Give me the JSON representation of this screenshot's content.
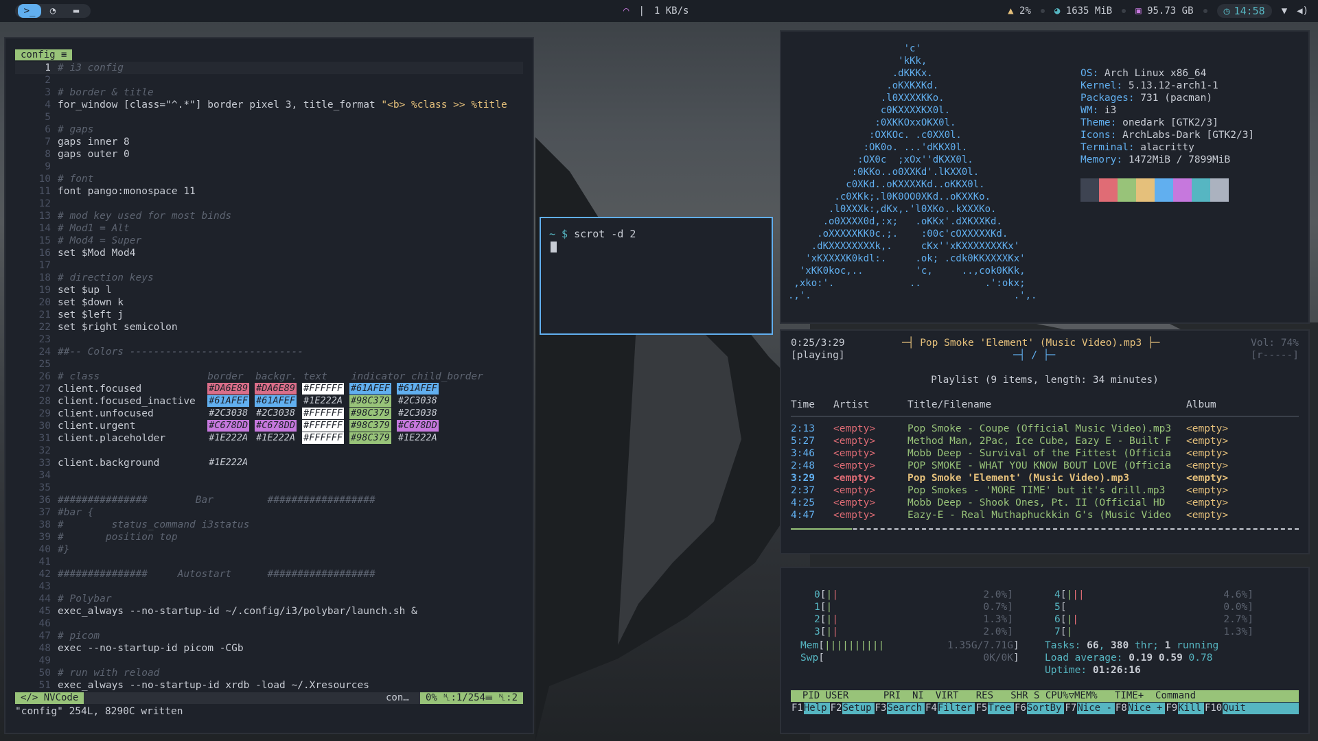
{
  "topbar": {
    "workspaces": [
      {
        "icon": "terminal-icon",
        "glyph": ">_",
        "active": true
      },
      {
        "icon": "firefox-icon",
        "glyph": "◔",
        "active": false
      },
      {
        "icon": "folder-icon",
        "glyph": "▬",
        "active": false
      }
    ],
    "network_speed": "1 KB/s",
    "cpu": "2%",
    "memory": "1635 MiB",
    "disk": "95.73 GB",
    "time": "14:58"
  },
  "editor": {
    "tab": "config ≡",
    "lines": [
      {
        "n": "1",
        "t": "# i3 config",
        "c": "cm"
      },
      {
        "n": "2",
        "t": "",
        "c": "txt"
      },
      {
        "n": "3",
        "t": "# border & title",
        "c": "cm"
      },
      {
        "n": "4",
        "t": "for_window [class=\"^.*\"] border pixel 3, title_format ",
        "s": "\"<b> %class >> %title",
        "c": "txt"
      },
      {
        "n": "5",
        "t": "",
        "c": "txt"
      },
      {
        "n": "6",
        "t": "# gaps",
        "c": "cm"
      },
      {
        "n": "7",
        "t": "gaps inner 8",
        "c": "txt"
      },
      {
        "n": "8",
        "t": "gaps outer 0",
        "c": "txt"
      },
      {
        "n": "9",
        "t": "",
        "c": "txt"
      },
      {
        "n": "10",
        "t": "# font",
        "c": "cm"
      },
      {
        "n": "11",
        "t": "font pango:monospace 11",
        "c": "txt"
      },
      {
        "n": "12",
        "t": "",
        "c": "txt"
      },
      {
        "n": "13",
        "t": "# mod key used for most binds",
        "c": "cm"
      },
      {
        "n": "14",
        "t": "# Mod1 = Alt",
        "c": "cm"
      },
      {
        "n": "15",
        "t": "# Mod4 = Super",
        "c": "cm"
      },
      {
        "n": "16",
        "t": "set $Mod Mod4",
        "c": "txt"
      },
      {
        "n": "17",
        "t": "",
        "c": "txt"
      },
      {
        "n": "18",
        "t": "# direction keys",
        "c": "cm"
      },
      {
        "n": "19",
        "t": "set $up l",
        "c": "txt"
      },
      {
        "n": "20",
        "t": "set $down k",
        "c": "txt"
      },
      {
        "n": "21",
        "t": "set $left j",
        "c": "txt"
      },
      {
        "n": "22",
        "t": "set $right semicolon",
        "c": "txt"
      },
      {
        "n": "23",
        "t": "",
        "c": "txt"
      },
      {
        "n": "24",
        "t": "##-- Colors -----------------------------",
        "c": "cm"
      },
      {
        "n": "25",
        "t": "",
        "c": "txt"
      },
      {
        "n": "26",
        "t": "# class                  border  backgr. text    indicator child_border",
        "c": "cm"
      },
      {
        "n": "27",
        "t": "client.focused           ",
        "sw": [
          [
            "#DA6E89",
            "#DA6E89",
            "#1e222a"
          ],
          [
            "#DA6E89",
            "#DA6E89",
            "#1e222a"
          ],
          [
            "#FFFFFF",
            "#FFFFFF",
            "#1e222a"
          ],
          [
            "#61AFEF",
            "#61AFEF",
            "#1e222a"
          ],
          [
            "#61AFEF",
            "#61AFEF",
            "#1e222a"
          ]
        ],
        "c": "txt"
      },
      {
        "n": "28",
        "t": "client.focused_inactive  ",
        "sw": [
          [
            "#61AFEF",
            "#61AFEF",
            "#1e222a"
          ],
          [
            "#61AFEF",
            "#61AFEF",
            "#1e222a"
          ],
          [
            "#1E222A",
            "",
            "#c8ccd4"
          ],
          [
            "#98C379",
            "#98C379",
            "#1e222a"
          ],
          [
            "#2C3038",
            "",
            "#c8ccd4"
          ]
        ],
        "c": "txt"
      },
      {
        "n": "29",
        "t": "client.unfocused         ",
        "sw": [
          [
            "#2C3038",
            "",
            "#c8ccd4"
          ],
          [
            "#2C3038",
            "",
            "#c8ccd4"
          ],
          [
            "#FFFFFF",
            "#FFFFFF",
            "#1e222a"
          ],
          [
            "#98C379",
            "#98C379",
            "#1e222a"
          ],
          [
            "#2C3038",
            "",
            "#c8ccd4"
          ]
        ],
        "c": "txt"
      },
      {
        "n": "30",
        "t": "client.urgent            ",
        "sw": [
          [
            "#C678DD",
            "#C678DD",
            "#1e222a"
          ],
          [
            "#C678DD",
            "#C678DD",
            "#1e222a"
          ],
          [
            "#FFFFFF",
            "#FFFFFF",
            "#1e222a"
          ],
          [
            "#98C379",
            "#98C379",
            "#1e222a"
          ],
          [
            "#C678DD",
            "#C678DD",
            "#1e222a"
          ]
        ],
        "c": "txt"
      },
      {
        "n": "31",
        "t": "client.placeholder       ",
        "sw": [
          [
            "#1E222A",
            "",
            "#c8ccd4"
          ],
          [
            "#1E222A",
            "",
            "#c8ccd4"
          ],
          [
            "#FFFFFF",
            "#FFFFFF",
            "#1e222a"
          ],
          [
            "#98C379",
            "#98C379",
            "#1e222a"
          ],
          [
            "#1E222A",
            "",
            "#c8ccd4"
          ]
        ],
        "c": "txt"
      },
      {
        "n": "32",
        "t": "",
        "c": "txt"
      },
      {
        "n": "33",
        "t": "client.background        ",
        "sw": [
          [
            "#1E222A",
            "",
            "#c8ccd4"
          ]
        ],
        "c": "txt"
      },
      {
        "n": "34",
        "t": "",
        "c": "txt"
      },
      {
        "n": "35",
        "t": "",
        "c": "txt"
      },
      {
        "n": "36",
        "t": "###############        Bar         ##################",
        "c": "cm"
      },
      {
        "n": "37",
        "t": "#bar {",
        "c": "cm"
      },
      {
        "n": "38",
        "t": "#        status_command i3status",
        "c": "cm"
      },
      {
        "n": "39",
        "t": "#       position top",
        "c": "cm"
      },
      {
        "n": "40",
        "t": "#}",
        "c": "cm"
      },
      {
        "n": "41",
        "t": "",
        "c": "txt"
      },
      {
        "n": "42",
        "t": "###############     Autostart      ##################",
        "c": "cm"
      },
      {
        "n": "43",
        "t": "",
        "c": "txt"
      },
      {
        "n": "44",
        "t": "# Polybar",
        "c": "cm"
      },
      {
        "n": "45",
        "t": "exec_always --no-startup-id ~/.config/i3/polybar/launch.sh &",
        "c": "txt"
      },
      {
        "n": "46",
        "t": "",
        "c": "txt"
      },
      {
        "n": "47",
        "t": "# picom",
        "c": "cm"
      },
      {
        "n": "48",
        "t": "exec --no-startup-id picom -CGb",
        "c": "txt"
      },
      {
        "n": "49",
        "t": "",
        "c": "txt"
      },
      {
        "n": "50",
        "t": "# run with reload",
        "c": "cm"
      },
      {
        "n": "51",
        "t": "exec_always --no-startup-id xrdb -load ~/.Xresources",
        "c": "txt"
      }
    ],
    "status": {
      "mode": "</> NVCode",
      "file": "con…",
      "position": "0% ␤:1/254☰ ␤:2"
    },
    "cmdline": "\"config\" 254L, 8290C written"
  },
  "terminal": {
    "prompt": "~ $ ",
    "command": "scrot -d 2"
  },
  "neofetch": {
    "logo": "                    'c'\n                   'kKk,\n                  .dKKKx.\n                 .oKXKXKd.\n                .l0XXXXKKo.\n                c0KXXXXKX0l.\n               :0XKKOxxOKX0l.\n              :OXKOc. .c0XX0l.\n             :OK0o. ...'dKKX0l.\n            :OX0c  ;xOx''dKXX0l.\n           :0KKo..o0XXKd'.lKXX0l.\n          c0XKd..oKXXXXKd..oKKX0l.\n        .c0XKk;.l0K0OO0XKd..oKXXKo.\n       .l0XXXk:,dKx,.'l0XKo..kXXXKo.\n      .o0XXXX0d,:x;   .oKKx'.dXKXXKd.\n     .oXXXXXKK0c.;.    :00c'cOXXXXXKd.\n    .dKXXXXXXXXk,.     cKx''xKXXXXXXXKx'\n   'xKXXXXK0kdl:.     .ok; .cdk0KKXXXXKx'\n  'xKK0koc,..         'c,     ..,cok0KKk,\n ,xko:'.             ..           .':okx;\n.,'.                                   .',.",
    "info": [
      {
        "k": "OS:",
        "v": " Arch Linux x86_64"
      },
      {
        "k": "Kernel:",
        "v": " 5.13.12-arch1-1"
      },
      {
        "k": "Packages:",
        "v": " 731 (pacman)"
      },
      {
        "k": "WM:",
        "v": " i3"
      },
      {
        "k": "Theme:",
        "v": " onedark [GTK2/3]"
      },
      {
        "k": "Icons:",
        "v": " ArchLabs-Dark [GTK2/3]"
      },
      {
        "k": "Terminal:",
        "v": " alacritty"
      },
      {
        "k": "Memory:",
        "v": " 1472MiB / 7899MiB"
      }
    ],
    "palette": [
      "#3e4452",
      "#E06C75",
      "#98C379",
      "#E5C07B",
      "#61AFEF",
      "#C678DD",
      "#56B6C2",
      "#ABB2BF"
    ]
  },
  "player": {
    "elapsed": "0:25/3:29",
    "state": "[playing]",
    "now_playing": "─┤ Pop Smoke 'Element' (Music Video).mp3 ├─",
    "controls": "─┤ / ├─",
    "volume": "Vol: 74%",
    "flags": "[r-----]",
    "playlist_header": "Playlist (9 items, length: 34 minutes)",
    "columns": [
      "Time",
      "Artist",
      "Title/Filename",
      "Album"
    ],
    "songs": [
      {
        "time": "2:13",
        "artist": "<empty>",
        "title": "Pop Smoke - Coupe (Official Music Video).mp3",
        "album": "<empty>",
        "current": false
      },
      {
        "time": "5:27",
        "artist": "<empty>",
        "title": "Method Man, 2Pac, Ice Cube, Eazy E - Built F",
        "album": "<empty>",
        "current": false
      },
      {
        "time": "3:46",
        "artist": "<empty>",
        "title": "Mobb Deep - Survival of the Fittest (Officia",
        "album": "<empty>",
        "current": false
      },
      {
        "time": "2:48",
        "artist": "<empty>",
        "title": "POP SMOKE - WHAT YOU KNOW BOUT LOVE (Officia",
        "album": "<empty>",
        "current": false
      },
      {
        "time": "3:29",
        "artist": "<empty>",
        "title": "Pop Smoke 'Element' (Music Video).mp3",
        "album": "<empty>",
        "current": true
      },
      {
        "time": "2:37",
        "artist": "<empty>",
        "title": "Pop Smokes - 'MORE TIME' but it's drill.mp3",
        "album": "<empty>",
        "current": false
      },
      {
        "time": "4:25",
        "artist": "<empty>",
        "title": "Mobb Deep - Shook Ones, Pt. II (Official HD",
        "album": "<empty>",
        "current": false
      },
      {
        "time": "4:47",
        "artist": "<empty>",
        "title": "Eazy-E - Real Muthaphuckkin G's (Music Video",
        "album": "<empty>",
        "current": false
      }
    ],
    "progress": 0.12
  },
  "htop": {
    "cpus_left": [
      {
        "id": "0",
        "bars": "||",
        "val": "2.0%"
      },
      {
        "id": "1",
        "bars": "|",
        "val": "0.7%"
      },
      {
        "id": "2",
        "bars": "||",
        "val": "1.3%"
      },
      {
        "id": "3",
        "bars": "||",
        "val": "2.0%"
      }
    ],
    "cpus_right": [
      {
        "id": "4",
        "bars": "|||",
        "val": "4.6%"
      },
      {
        "id": "5",
        "bars": "",
        "val": "0.0%"
      },
      {
        "id": "6",
        "bars": "||",
        "val": "2.7%"
      },
      {
        "id": "7",
        "bars": "|",
        "val": "1.3%"
      }
    ],
    "mem": {
      "label": "Mem",
      "bars": "||||||||||",
      "val": "1.35G/7.71G"
    },
    "swp": {
      "label": "Swp",
      "bars": "",
      "val": "0K/0K"
    },
    "tasks_label": "Tasks: ",
    "tasks": "66",
    "thr": "380",
    "running": "1",
    "load_label": "Load average: ",
    "load1": "0.19",
    "load5": "0.59",
    "load15": "0.78",
    "uptime_label": "Uptime: ",
    "uptime": "01:26:16",
    "header": "  PID USER      PRI  NI  VIRT   RES   SHR S CPU%▽MEM%   TIME+  Command",
    "footer": [
      {
        "k": "F1",
        "l": "Help"
      },
      {
        "k": "F2",
        "l": "Setup"
      },
      {
        "k": "F3",
        "l": "Search"
      },
      {
        "k": "F4",
        "l": "Filter"
      },
      {
        "k": "F5",
        "l": "Tree"
      },
      {
        "k": "F6",
        "l": "SortBy"
      },
      {
        "k": "F7",
        "l": "Nice -"
      },
      {
        "k": "F8",
        "l": "Nice +"
      },
      {
        "k": "F9",
        "l": "Kill"
      },
      {
        "k": "F10",
        "l": "Quit"
      }
    ]
  }
}
